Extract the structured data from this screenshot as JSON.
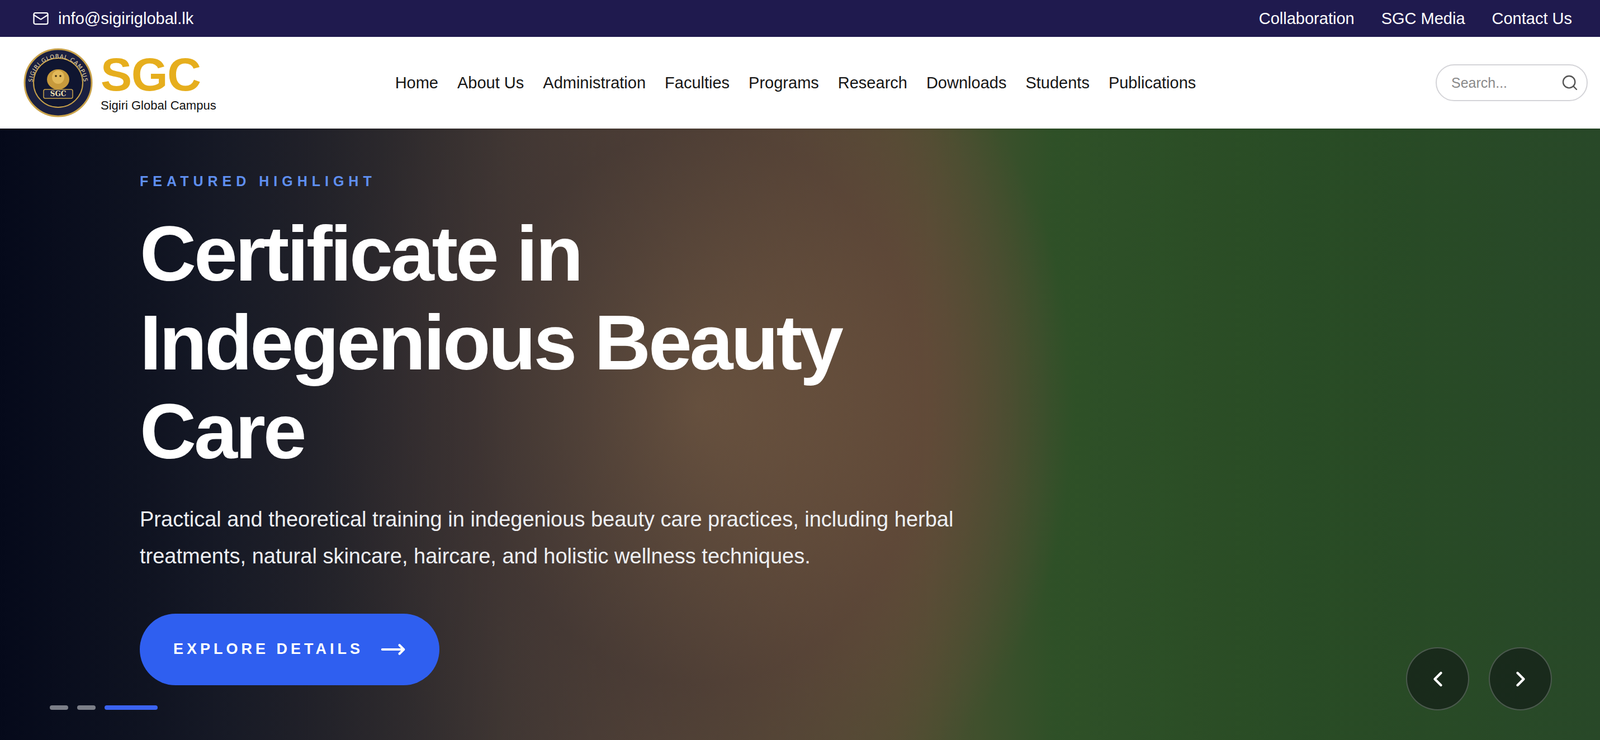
{
  "top_bar": {
    "email": "info@sigiriglobal.lk",
    "links": [
      "Collaboration",
      "SGC Media",
      "Contact Us"
    ]
  },
  "header": {
    "logo": {
      "ring_text": "SIGIRI GLOBAL CAMPUS",
      "center_text": "SGC",
      "title": "SGC",
      "subtitle": "Sigiri Global Campus"
    },
    "nav": [
      "Home",
      "About Us",
      "Administration",
      "Faculties",
      "Programs",
      "Research",
      "Downloads",
      "Students",
      "Publications"
    ],
    "search": {
      "placeholder": "Search..."
    }
  },
  "hero": {
    "eyebrow": "FEATURED HIGHLIGHT",
    "title": "Certificate in Indegenious Beauty Care",
    "description": "Practical and theoretical training in indegenious beauty care practices, including herbal treatments, natural skincare, haircare, and holistic wellness techniques.",
    "button": "EXPLORE DETAILS",
    "slides": [
      {
        "selected": false
      },
      {
        "selected": false
      },
      {
        "selected": true
      }
    ]
  }
}
